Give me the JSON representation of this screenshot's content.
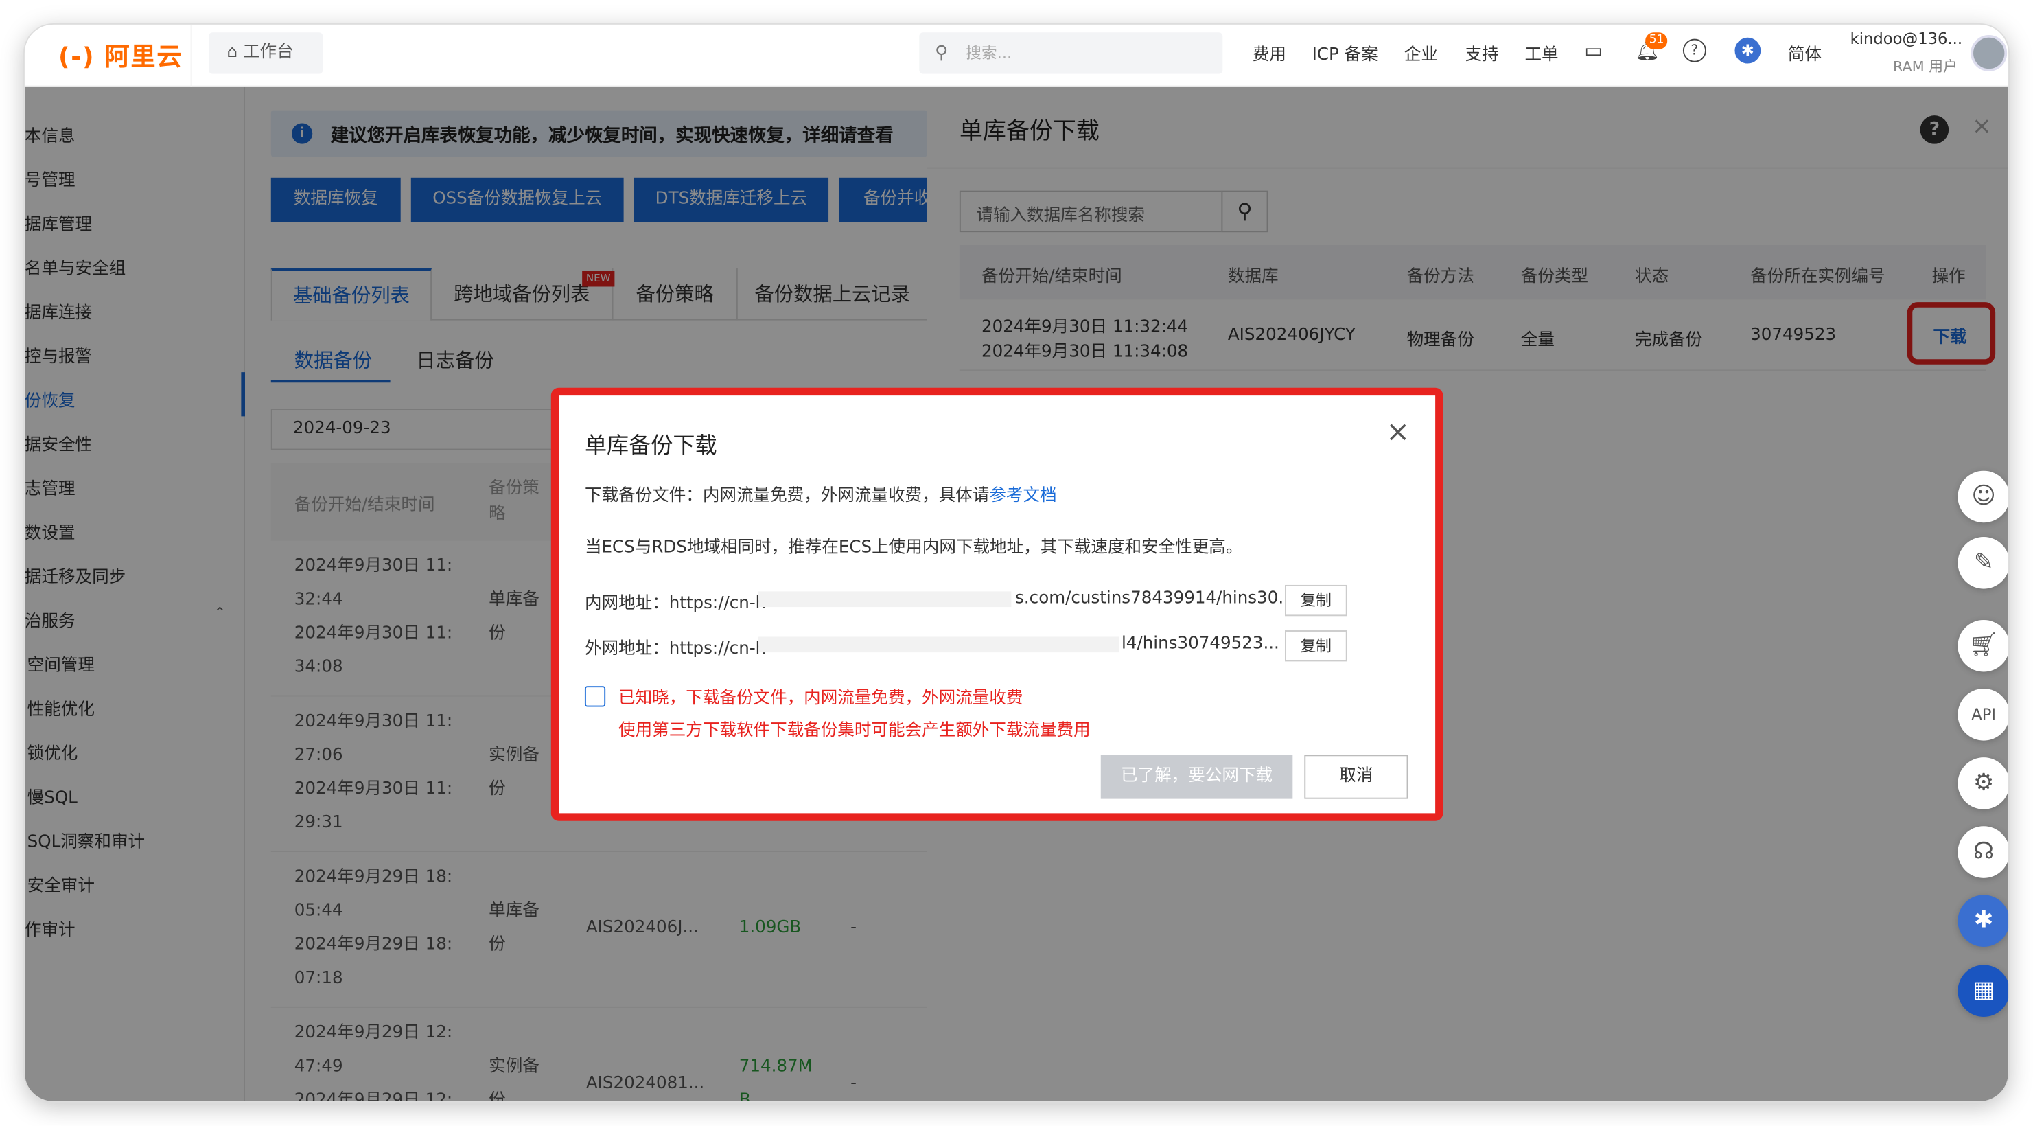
{
  "topbar": {
    "logo": "(-) 阿里云",
    "workbench": "工作台",
    "search_placeholder": "搜索...",
    "nav": [
      "费用",
      "ICP 备案",
      "企业",
      "支持",
      "工单"
    ],
    "notifications_count": "51",
    "lang": "简体",
    "account": "kindoo@136...",
    "account_type": "RAM 用户"
  },
  "sidebar": {
    "items": [
      "本信息",
      "号管理",
      "据库管理",
      "名单与安全组",
      "据库连接",
      "控与报警",
      "份恢复",
      "据安全性",
      "志管理",
      "数设置",
      "据迁移及同步",
      "治服务",
      "空间管理",
      "性能优化",
      "锁优化",
      "慢SQL",
      "SQL洞察和审计",
      "安全审计",
      "作审计"
    ]
  },
  "main": {
    "info": "建议您开启库表恢复功能，减少恢复时间，实现快速恢复，详细请查看",
    "buttons": [
      "数据库恢复",
      "OSS备份数据恢复上云",
      "DTS数据库迁移上云",
      "备份并收"
    ],
    "tabs": [
      "基础备份列表",
      "跨地域备份列表",
      "备份策略",
      "备份数据上云记录"
    ],
    "tab_new": "NEW",
    "subtabs": [
      "数据备份",
      "日志备份"
    ],
    "date": "2024-09-23",
    "headers": [
      "备份开始/结束时间",
      "备份策略"
    ],
    "rows": [
      {
        "time": [
          "2024年9月30日 11:",
          "32:44",
          "2024年9月30日 11:",
          "34:08"
        ],
        "strategy": [
          "单库备",
          "份"
        ],
        "db": "",
        "size": "",
        "dash": ""
      },
      {
        "time": [
          "2024年9月30日 11:",
          "27:06",
          "2024年9月30日 11:",
          "29:31"
        ],
        "strategy": [
          "实例备",
          "份"
        ],
        "db": "",
        "size": "",
        "dash": ""
      },
      {
        "time": [
          "2024年9月29日 18:",
          "05:44",
          "2024年9月29日 18:",
          "07:18"
        ],
        "strategy": [
          "单库备",
          "份"
        ],
        "db": "AIS202406J...",
        "size": "1.09GB",
        "dash": "-"
      },
      {
        "time": [
          "2024年9月29日 12:",
          "47:49",
          "2024年9月29日 12:",
          ""
        ],
        "strategy": [
          "实例备",
          "份"
        ],
        "db": "AIS2024081...",
        "size": "714.87M",
        "size2": "B",
        "dash": "-"
      }
    ]
  },
  "panel": {
    "title": "单库备份下载",
    "search_placeholder": "请输入数据库名称搜索",
    "headers": [
      "备份开始/结束时间",
      "数据库",
      "备份方法",
      "备份类型",
      "状态",
      "备份所在实例编号",
      "操作"
    ],
    "row": {
      "start": "2024年9月30日 11:32:44",
      "end": "2024年9月30日 11:34:08",
      "db": "AIS202406JYCY",
      "method": "物理备份",
      "type": "全量",
      "status": "完成备份",
      "instance": "30749523",
      "action": "下载"
    }
  },
  "modal": {
    "title": "单库备份下载",
    "line1": "下载备份文件：内网流量免费，外网流量收费，具体请",
    "line1_link": "参考文档",
    "line2": "当ECS与RDS地域相同时，推荐在ECS上使用内网下载地址，其下载速度和安全性更高。",
    "intranet_label": "内网地址：https://cn-h",
    "intranet_tail": "s.com/custins78439914/hins30...",
    "internet_label": "外网地址：https://cn-h",
    "internet_tail": "l4/hins30749523...",
    "copy": "复制",
    "ack1": "已知晓，下载备份文件，内网流量免费，外网流量收费",
    "ack2": "使用第三方下载软件下载备份集时可能会产生额外下载流量费用",
    "confirm": "已了解，要公网下载",
    "cancel": "取消"
  },
  "colors": {
    "accent": "#1a6bd8",
    "brand": "#ff6a00",
    "highlight": "#e8231f"
  }
}
